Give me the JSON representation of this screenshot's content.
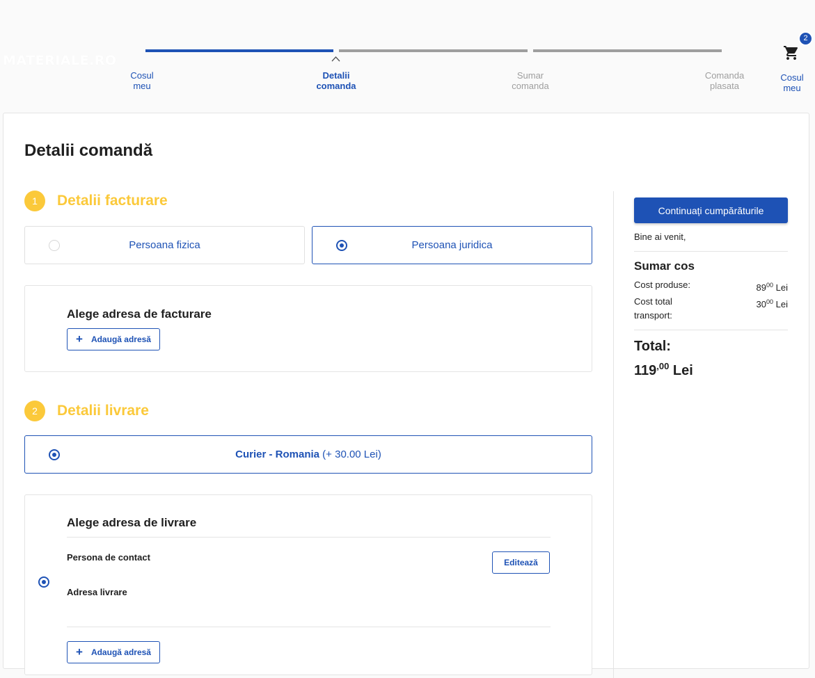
{
  "header": {
    "logo_text": "MATERIALE.RO",
    "steps": [
      {
        "label": "Cosul\nmeu",
        "state": "done"
      },
      {
        "label": "Detalii\ncomanda",
        "state": "current"
      },
      {
        "label": "Sumar\ncomanda",
        "state": "pending"
      },
      {
        "label": "Comanda\nplasata",
        "state": "pending"
      }
    ],
    "cart": {
      "badge": "2",
      "label": "Cosul\nmeu",
      "icon": "cart-icon"
    }
  },
  "page": {
    "title": "Detalii comandă"
  },
  "billing": {
    "number": "1",
    "title": "Detalii facturare",
    "options": [
      {
        "label": "Persoana fizica",
        "selected": false
      },
      {
        "label": "Persoana juridica",
        "selected": true
      }
    ],
    "address_title": "Alege adresa de facturare",
    "add_address": "Adaugă adresă"
  },
  "delivery": {
    "number": "2",
    "title": "Detalii livrare",
    "method_name": "Curier - Romania",
    "method_price": " (+ 30.00 Lei)",
    "address_title": "Alege adresa de livrare",
    "contact_label": "Persona de contact",
    "address_label": "Adresa livrare",
    "edit": "Editează",
    "add_address": "Adaugă adresă"
  },
  "sidebar": {
    "continue_button": "Continuați cumpărăturile",
    "welcome": "Bine ai venit, ",
    "summary_title": "Sumar cos",
    "rows": [
      {
        "label": "Cost produse:",
        "int": "89",
        "dec": "00",
        "unit": " Lei"
      },
      {
        "label": "Cost total transport:",
        "int": "30",
        "dec": "00",
        "unit": " Lei"
      }
    ],
    "total_label": "Total:",
    "total": {
      "int": "119",
      "dec": ",00",
      "unit": " Lei"
    }
  },
  "colors": {
    "primary": "#1e52b5",
    "accent": "#fbc93a",
    "muted": "#9e9e9e"
  }
}
